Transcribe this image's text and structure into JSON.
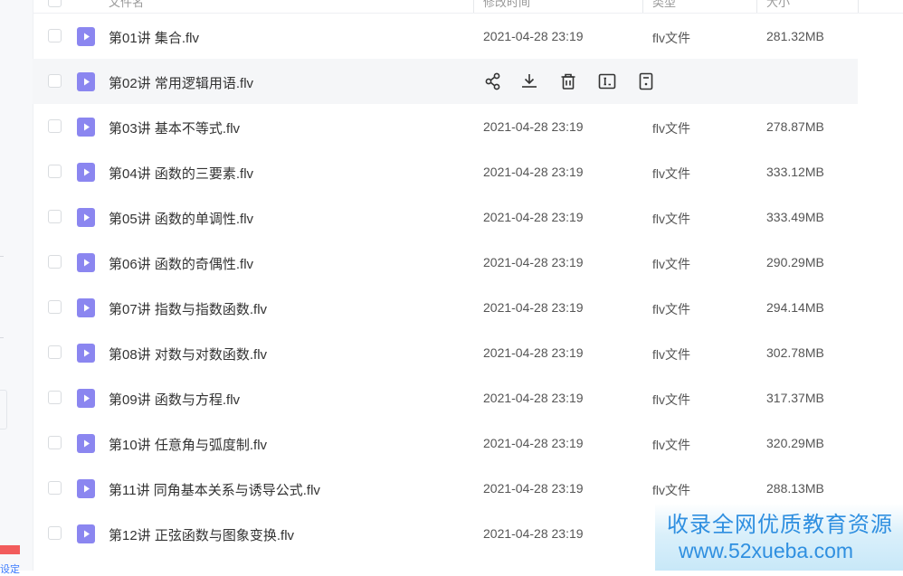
{
  "header": {
    "columns": [
      "文件名",
      "修改时间",
      "类型",
      "大小"
    ]
  },
  "sidebar": {
    "partial_text": "设定"
  },
  "hover_actions": [
    "share-icon",
    "download-icon",
    "delete-icon",
    "rename-icon",
    "more-icon"
  ],
  "files": [
    {
      "name": "第01讲 集合.flv",
      "date": "2021-04-28 23:19",
      "type": "flv文件",
      "size": "281.32MB"
    },
    {
      "name": "第02讲 常用逻辑用语.flv",
      "date": "",
      "type": "",
      "size": "",
      "hovered": true
    },
    {
      "name": "第03讲 基本不等式.flv",
      "date": "2021-04-28 23:19",
      "type": "flv文件",
      "size": "278.87MB"
    },
    {
      "name": "第04讲 函数的三要素.flv",
      "date": "2021-04-28 23:19",
      "type": "flv文件",
      "size": "333.12MB"
    },
    {
      "name": "第05讲 函数的单调性.flv",
      "date": "2021-04-28 23:19",
      "type": "flv文件",
      "size": "333.49MB"
    },
    {
      "name": "第06讲 函数的奇偶性.flv",
      "date": "2021-04-28 23:19",
      "type": "flv文件",
      "size": "290.29MB"
    },
    {
      "name": "第07讲 指数与指数函数.flv",
      "date": "2021-04-28 23:19",
      "type": "flv文件",
      "size": "294.14MB"
    },
    {
      "name": "第08讲 对数与对数函数.flv",
      "date": "2021-04-28 23:19",
      "type": "flv文件",
      "size": "302.78MB"
    },
    {
      "name": "第09讲 函数与方程.flv",
      "date": "2021-04-28 23:19",
      "type": "flv文件",
      "size": "317.37MB"
    },
    {
      "name": "第10讲 任意角与弧度制.flv",
      "date": "2021-04-28 23:19",
      "type": "flv文件",
      "size": "320.29MB"
    },
    {
      "name": "第11讲 同角基本关系与诱导公式.flv",
      "date": "2021-04-28 23:19",
      "type": "flv文件",
      "size": "288.13MB"
    },
    {
      "name": "第12讲 正弦函数与图象变换.flv",
      "date": "2021-04-28 23:19",
      "type": "",
      "size": ""
    }
  ],
  "watermark": {
    "line1": "收录全网优质教育资源",
    "line2": "www.52xueba.com"
  },
  "colors": {
    "file_icon": "#8b86f0",
    "hover_row": "#f5f6f8",
    "watermark_text": "#2f8fe0"
  }
}
